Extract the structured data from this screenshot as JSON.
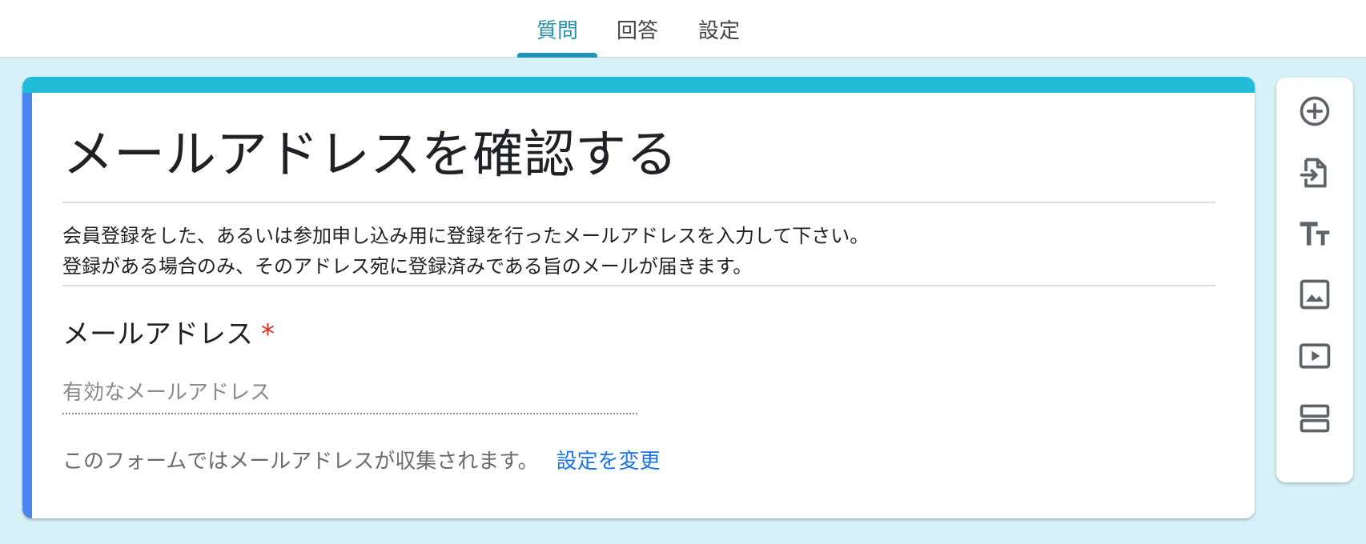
{
  "tabs": [
    {
      "label": "質問",
      "active": true
    },
    {
      "label": "回答",
      "active": false
    },
    {
      "label": "設定",
      "active": false
    }
  ],
  "form": {
    "title": "メールアドレスを確認する",
    "description_line1": "会員登録をした、あるいは参加申し込み用に登録を行ったメールアドレスを入力して下さい。",
    "description_line2": "登録がある場合のみ、そのアドレス宛に登録済みである旨のメールが届きます。",
    "question_label": "メールアドレス",
    "required_mark": "*",
    "email_placeholder": "有効なメールアドレス",
    "collect_note": "このフォームではメールアドレスが収集されます。",
    "change_settings_link": "設定を変更"
  },
  "toolbar": {
    "icons": [
      "add-question-icon",
      "import-questions-icon",
      "add-title-icon",
      "add-image-icon",
      "add-video-icon",
      "add-section-icon"
    ]
  },
  "colors": {
    "accent_band": "#23bcd6",
    "left_bar": "#4a86f0",
    "active_tab": "#2a8fa8",
    "tab_indicator": "#1f93b5",
    "link": "#1a73e8",
    "required": "#d93025",
    "page_bg": "#d6f1f7"
  }
}
